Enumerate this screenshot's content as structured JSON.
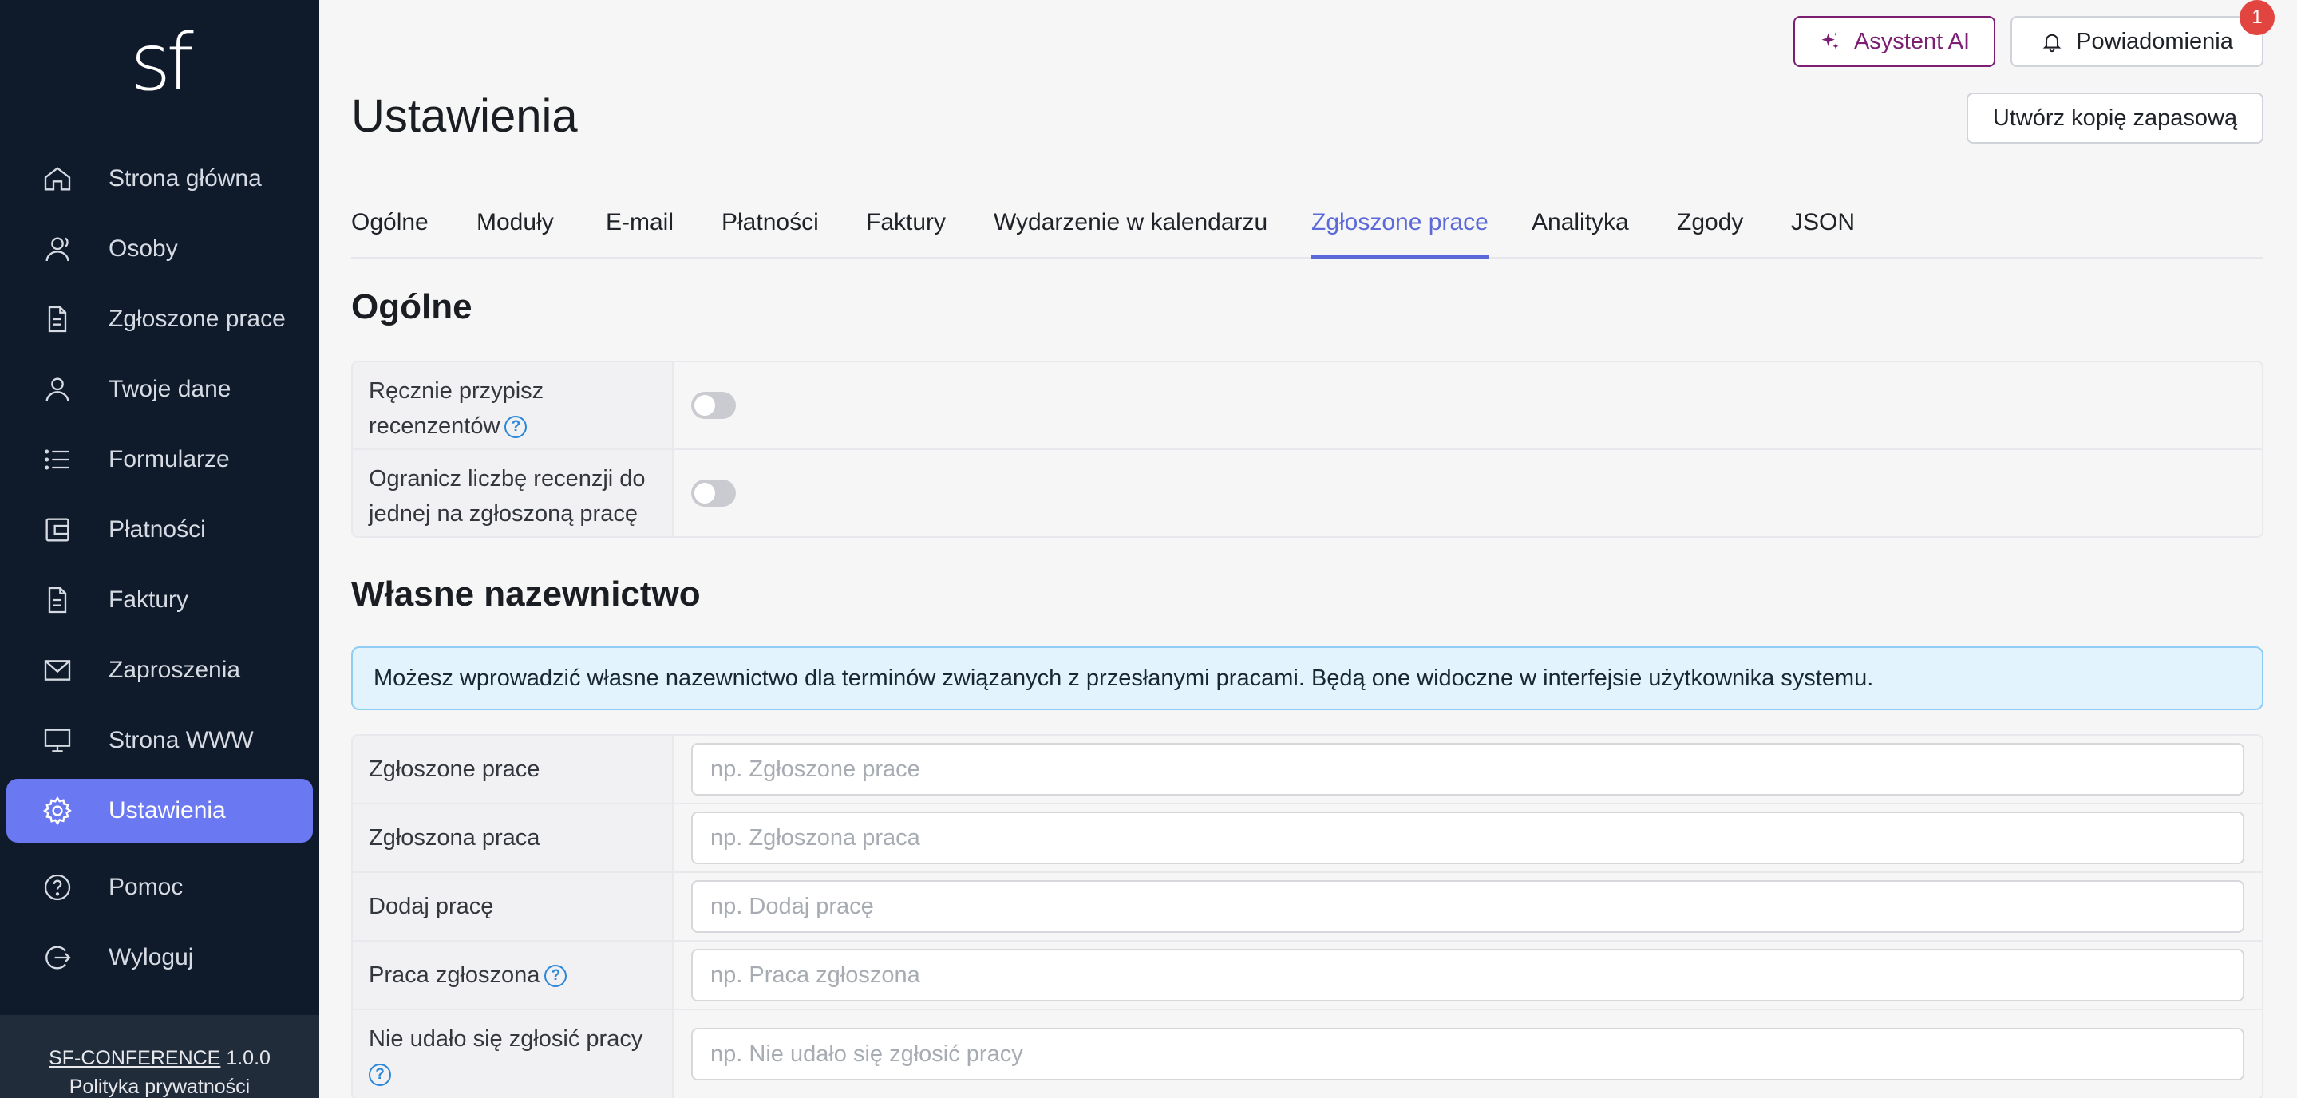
{
  "app": {
    "logo": "sf"
  },
  "sidebar": {
    "items": [
      {
        "label": "Strona główna",
        "icon": "home-icon"
      },
      {
        "label": "Osoby",
        "icon": "people-icon"
      },
      {
        "label": "Zgłoszone prace",
        "icon": "document-icon"
      },
      {
        "label": "Twoje dane",
        "icon": "user-icon"
      },
      {
        "label": "Formularze",
        "icon": "list-icon"
      },
      {
        "label": "Płatności",
        "icon": "wallet-icon"
      },
      {
        "label": "Faktury",
        "icon": "invoice-icon"
      },
      {
        "label": "Zaproszenia",
        "icon": "mail-icon"
      },
      {
        "label": "Strona WWW",
        "icon": "monitor-icon"
      },
      {
        "label": "Ustawienia",
        "icon": "gear-icon",
        "active": true
      },
      {
        "label": "Pomoc",
        "icon": "help-circle-icon"
      },
      {
        "label": "Wyloguj",
        "icon": "logout-icon"
      }
    ],
    "footer": {
      "brand": "SF-CONFERENCE",
      "version": "1.0.0",
      "privacy": "Polityka prywatności"
    }
  },
  "header": {
    "ai_button": "Asystent AI",
    "notifications_button": "Powiadomienia",
    "notifications_count": "1",
    "backup_button": "Utwórz kopię zapasową",
    "title": "Ustawienia"
  },
  "tabs": [
    {
      "label": "Ogólne"
    },
    {
      "label": "Moduły"
    },
    {
      "label": "E-mail"
    },
    {
      "label": "Płatności"
    },
    {
      "label": "Faktury"
    },
    {
      "label": "Wydarzenie w kalendarzu"
    },
    {
      "label": "Zgłoszone prace",
      "active": true
    },
    {
      "label": "Analityka"
    },
    {
      "label": "Zgody"
    },
    {
      "label": "JSON"
    }
  ],
  "general": {
    "title": "Ogólne",
    "rows": [
      {
        "label": "Ręcznie przypisz recenzentów",
        "enabled": false
      },
      {
        "label": "Ogranicz liczbę recenzji do jednej na zgłoszoną pracę",
        "enabled": false
      }
    ]
  },
  "naming": {
    "title": "Własne nazewnictwo",
    "info": "Możesz wprowadzić własne nazewnictwo dla terminów związanych z przesłanymi pracami. Będą one widoczne w interfejsie użytkownika systemu.",
    "rows": [
      {
        "label": "Zgłoszone prace",
        "value": "",
        "placeholder": "np. Zgłoszone prace"
      },
      {
        "label": "Zgłoszona praca",
        "value": "",
        "placeholder": "np. Zgłoszona praca"
      },
      {
        "label": "Dodaj pracę",
        "value": "",
        "placeholder": "np. Dodaj pracę"
      },
      {
        "label": "Praca zgłoszona",
        "value": "",
        "placeholder": "np. Praca zgłoszona"
      },
      {
        "label": "Nie udało się zgłosić pracy",
        "value": "",
        "placeholder": "np. Nie udało się zgłosić pracy"
      }
    ]
  },
  "colors": {
    "sidebar_bg": "#0f1b2b",
    "accent": "#6a78f2",
    "ai_accent": "#7c1f73",
    "badge": "#e2453f",
    "info_bg": "#e3f3fe"
  }
}
